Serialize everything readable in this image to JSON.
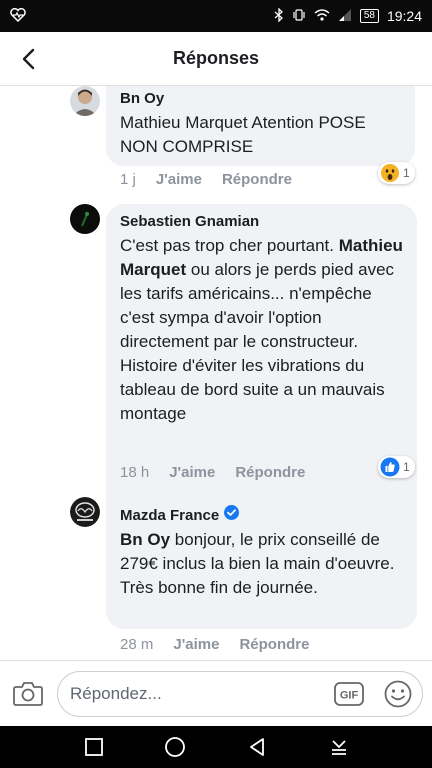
{
  "status_bar": {
    "battery": "58",
    "time": "19:24"
  },
  "header": {
    "title": "Réponses"
  },
  "comments": [
    {
      "author": "Bn Oy",
      "text": "Mathieu Marquet Atention POSE NON COMPRISE",
      "time": "1 j",
      "like_label": "J'aime",
      "reply_label": "Répondre",
      "reaction_count": "1",
      "reaction_icon": "wow-emoji-icon"
    },
    {
      "author": "Sebastien Gnamian",
      "mention": "Mathieu Marquet",
      "text_before": "C'est pas trop cher pourtant.",
      "text_after": "ou alors je perds pied avec les tarifs américains... n'empêche c'est sympa d'avoir l'option directement par le constructeur. Histoire d'éviter les vibrations du tableau de bord suite a un mauvais montage",
      "time": "18 h",
      "like_label": "J'aime",
      "reply_label": "Répondre",
      "reaction_count": "1",
      "reaction_icon": "like-icon"
    },
    {
      "author": "Mazda France",
      "verified": true,
      "mention": "Bn Oy",
      "text_after": "bonjour, le prix conseillé de 279€ inclus la bien la main d'oeuvre. Très bonne fin de journée.",
      "time": "28 m",
      "like_label": "J'aime",
      "reply_label": "Répondre"
    }
  ],
  "composer": {
    "placeholder": "Répondez...",
    "gif_label": "GIF"
  },
  "colors": {
    "accent": "#1877f2",
    "bubble": "#f0f2f5",
    "meta": "#8d949e"
  }
}
